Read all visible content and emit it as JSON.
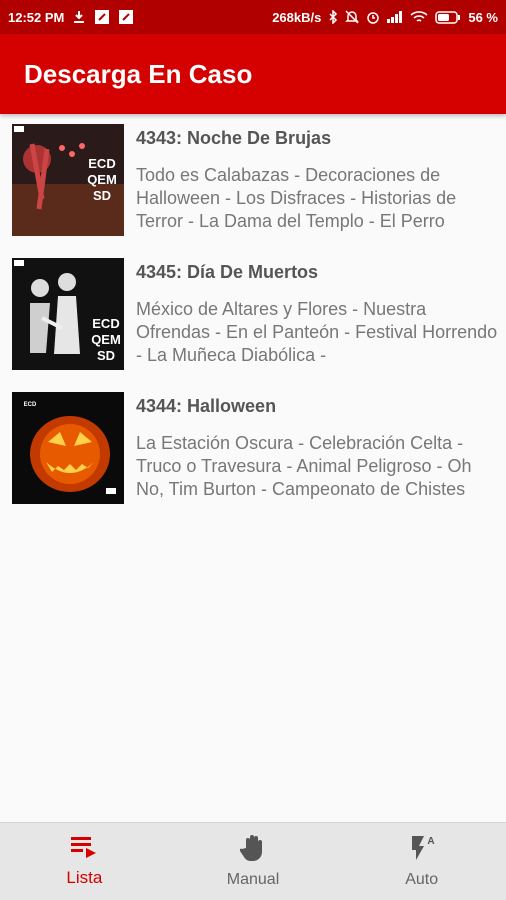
{
  "status": {
    "time": "12:52 PM",
    "speed": "268kB/s",
    "battery": "56 %"
  },
  "app": {
    "title": "Descarga En Caso"
  },
  "episodes": [
    {
      "title": "4343: Noche De Brujas",
      "description": "Todo es Calabazas - Decoraciones de Halloween - Los Disfraces - Historias de Terror - La Dama del Templo - El Perro",
      "cover_text": "ECD QEM SD"
    },
    {
      "title": "4345: Día De Muertos",
      "description": "México de Altares y Flores - Nuestra Ofrendas - En el Panteón - Festival Horrendo - La Muñeca Diabólica -",
      "cover_text": "ECD QEM SD"
    },
    {
      "title": "4344: Halloween",
      "description": "La Estación Oscura - Celebración Celta - Truco o Travesura - Animal Peligroso - Oh No, Tim Burton - Campeonato de Chistes",
      "cover_text": "ECD QEM SD"
    }
  ],
  "nav": {
    "lista": "Lista",
    "manual": "Manual",
    "auto": "Auto",
    "active": "lista"
  },
  "colors": {
    "statusbar": "#b00000",
    "appbar": "#d50000",
    "accent": "#d50000"
  }
}
